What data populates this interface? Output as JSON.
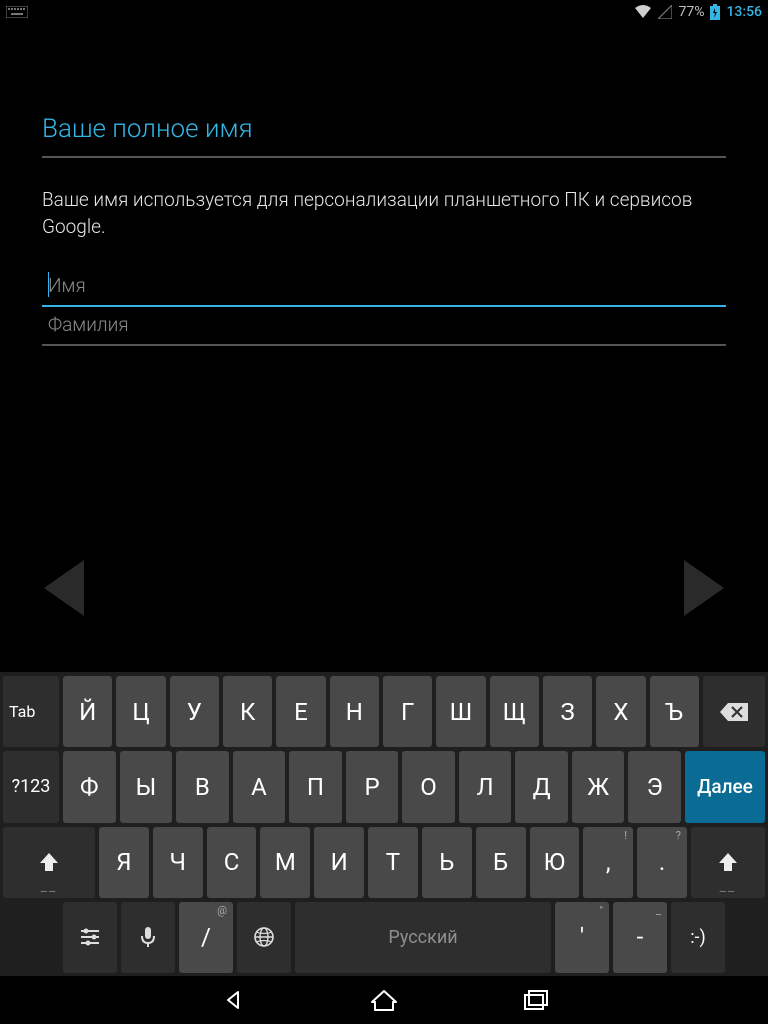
{
  "status": {
    "battery_pct": "77%",
    "time": "13:56"
  },
  "form": {
    "title": "Ваше полное имя",
    "description": "Ваше имя используется для персонализации планшетного ПК и сервисов Google.",
    "first_name_placeholder": "Имя",
    "first_name_value": "",
    "last_name_placeholder": "Фамилия",
    "last_name_value": ""
  },
  "keyboard": {
    "row1": [
      "Й",
      "Ц",
      "У",
      "К",
      "Е",
      "Н",
      "Г",
      "Ш",
      "Щ",
      "З",
      "Х",
      "Ъ"
    ],
    "tab_label": "Tab",
    "row2": [
      "Ф",
      "Ы",
      "В",
      "А",
      "П",
      "Р",
      "О",
      "Л",
      "Д",
      "Ж",
      "Э"
    ],
    "sym_label": "?123",
    "next_label": "Далее",
    "row3": [
      "Я",
      "Ч",
      "С",
      "М",
      "И",
      "Т",
      "Ь",
      "Б",
      "Ю",
      ",",
      "."
    ],
    "row3_hints": {
      "comma": "!",
      "period": "?"
    },
    "row4": {
      "slash": "/",
      "slash_hint": "@",
      "space_label": "Русский",
      "quote": "'",
      "quote_hint": "\"",
      "dash": "-",
      "dash_hint": "_",
      "smile": ":-)"
    }
  }
}
